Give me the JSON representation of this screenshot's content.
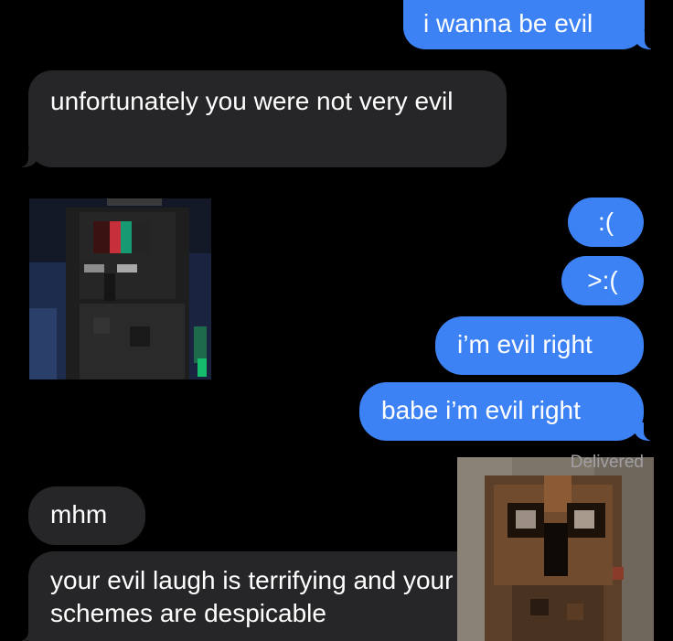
{
  "messages": [
    {
      "text": "i wanna be evil",
      "direction": "outgoing"
    },
    {
      "text": "unfortunately you were not very evil",
      "direction": "incoming"
    },
    {
      "text": ":(",
      "direction": "outgoing"
    },
    {
      "text": ">:(",
      "direction": "outgoing"
    },
    {
      "text": "i’m evil right",
      "direction": "outgoing"
    },
    {
      "text": "babe i’m evil right",
      "direction": "outgoing"
    },
    {
      "text": "mhm",
      "direction": "incoming"
    },
    {
      "text": "your evil laugh is terrifying and your schemes are despicable",
      "direction": "incoming"
    }
  ],
  "status": {
    "delivered": "Delivered"
  },
  "stickers": [
    {
      "icon": "dark-pixel-character-sticker"
    },
    {
      "icon": "brown-pixel-character-sticker"
    }
  ],
  "colors": {
    "outgoing": "#3d82f5",
    "incoming": "#262628",
    "background": "#000000"
  }
}
